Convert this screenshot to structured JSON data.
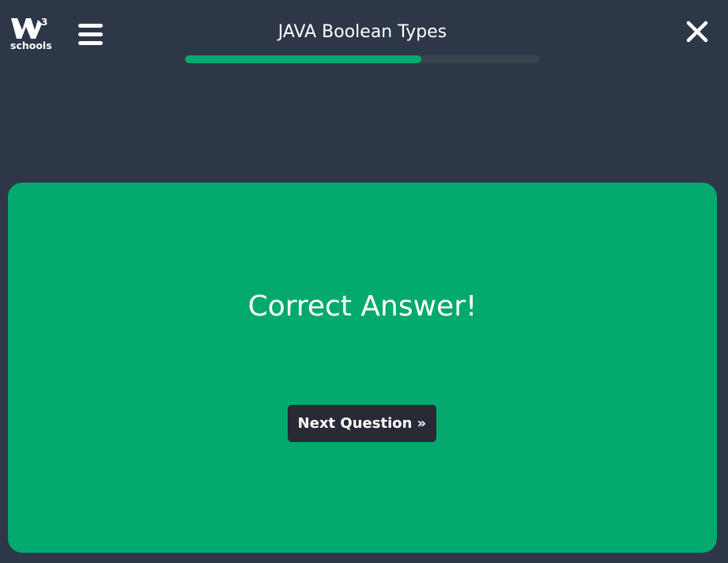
{
  "header": {
    "logo_text": "schools",
    "logo_superscript": "3",
    "title": "JAVA Boolean Types",
    "progress_percent": 66.5
  },
  "result": {
    "message": "Correct Answer!",
    "next_label": "Next Question »"
  },
  "colors": {
    "background": "#2d3748",
    "accent_green": "#04aa6d",
    "button_dark": "#282a35",
    "progress_track": "#38444d"
  },
  "icons": {
    "logo": "w3schools-logo-icon",
    "menu": "hamburger-menu-icon",
    "close": "close-icon"
  }
}
